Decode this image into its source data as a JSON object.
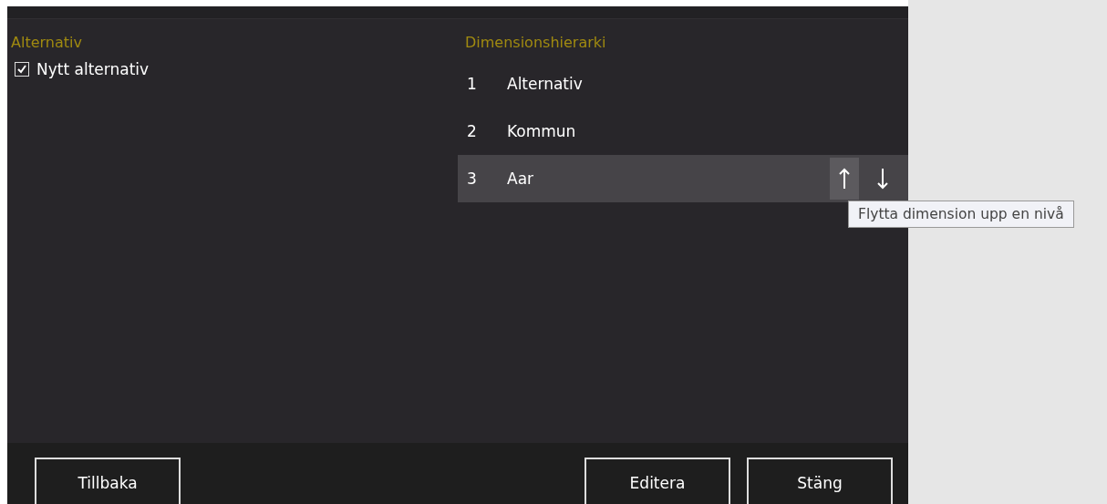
{
  "options": {
    "heading": "Alternativ",
    "items": [
      {
        "label": "Nytt alternativ",
        "checked": true
      }
    ]
  },
  "hierarchy": {
    "heading": "Dimensionshierarki",
    "rows": [
      {
        "number": "1",
        "name": "Alternativ",
        "selected": false
      },
      {
        "number": "2",
        "name": "Kommun",
        "selected": false
      },
      {
        "number": "3",
        "name": "Aar",
        "selected": true
      }
    ]
  },
  "tooltip": "Flytta dimension upp en nivå",
  "footer": {
    "left": [
      "Tillbaka"
    ],
    "right": [
      "Editera",
      "Stäng"
    ]
  }
}
